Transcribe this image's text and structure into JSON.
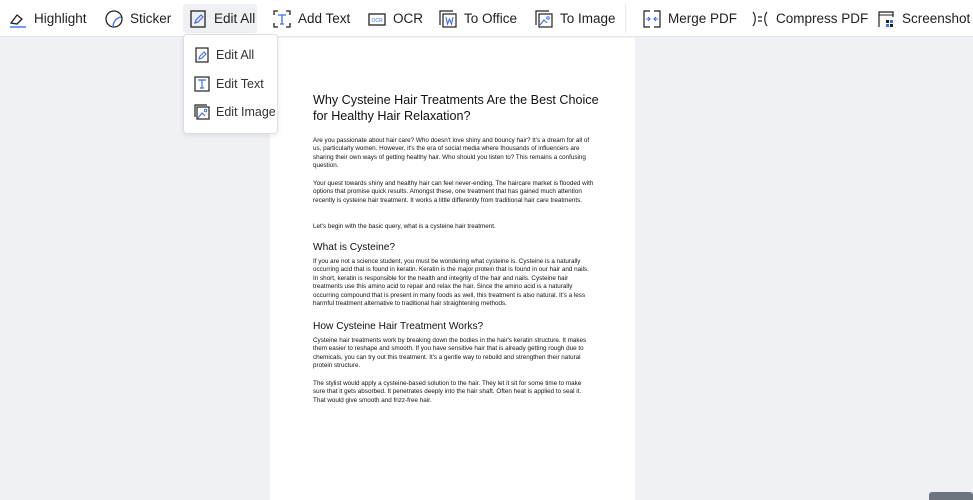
{
  "toolbar": {
    "items": [
      {
        "label": "Highlight",
        "icon": "highlight-icon"
      },
      {
        "label": "Sticker",
        "icon": "sticker-icon"
      },
      {
        "label": "Edit All",
        "icon": "edit-all-icon",
        "active": true
      },
      {
        "label": "Add Text",
        "icon": "add-text-icon"
      },
      {
        "label": "OCR",
        "icon": "ocr-icon"
      },
      {
        "label": "To Office",
        "icon": "to-office-icon"
      },
      {
        "label": "To Image",
        "icon": "to-image-icon"
      },
      {
        "label": "Merge PDF",
        "icon": "merge-pdf-icon"
      },
      {
        "label": "Compress PDF",
        "icon": "compress-pdf-icon"
      },
      {
        "label": "Screenshot",
        "icon": "screenshot-icon"
      }
    ],
    "accent": "#3d6df2"
  },
  "dropdown": {
    "items": [
      {
        "label": "Edit All"
      },
      {
        "label": "Edit Text"
      },
      {
        "label": "Edit Image"
      }
    ]
  },
  "document": {
    "title": "Why Cysteine Hair Treatments Are the Best Choice for Healthy Hair Relaxation?",
    "p1": "Are you passionate about hair care? Who doesn't love shiny and bouncy hair? It's a dream for all of us, particularly women. However, it's the era of social media where thousands of influencers are sharing their own ways of getting healthy hair. Who should you listen to? This remains a confusing question.",
    "p2": "Your quest towards shiny and healthy hair can feel never-ending. The haircare market is flooded with options that promise quick results. Amongst these, one treatment that has gained much attention recently is cysteine hair treatment. It works a little differently from traditional hair care treatments.",
    "p3": "Let's begin with the basic query, what is a cysteine hair treatment.",
    "h2a": "What is Cysteine?",
    "p4": "If you are not a science student, you must be wondering what cysteine is. Cysteine is a naturally occurring acid that is found in keratin. Keratin is the major protein that is found in our hair and nails. In short, keratin is responsible for the health and integrity of the hair and nails. Cysteine hair treatments use this amino acid to repair and relax the hair. Since the amino acid is a naturally occurring compound that is present in many foods as well, this treatment is also natural. It's a less harmful treatment alternative to traditional hair straightening methods.",
    "h2b": "How Cysteine Hair Treatment Works?",
    "p5": "Cysteine hair treatments work by breaking down the bodies in the hair's keratin structure. It makes them easier to reshape and smooth. If you have sensitive hair that is already getting rough due to chemicals, you can try out this treatment. It's a gentle way to rebuild and strengthen their natural protein structure.",
    "p6": "The stylist would apply a cysteine-based solution to the hair. They let it sit for some time to make sure that it gets absorbed. It penetrates deeply into the hair shaft. Often heat is applied to seal it. That would give smooth and frizz-free hair."
  }
}
